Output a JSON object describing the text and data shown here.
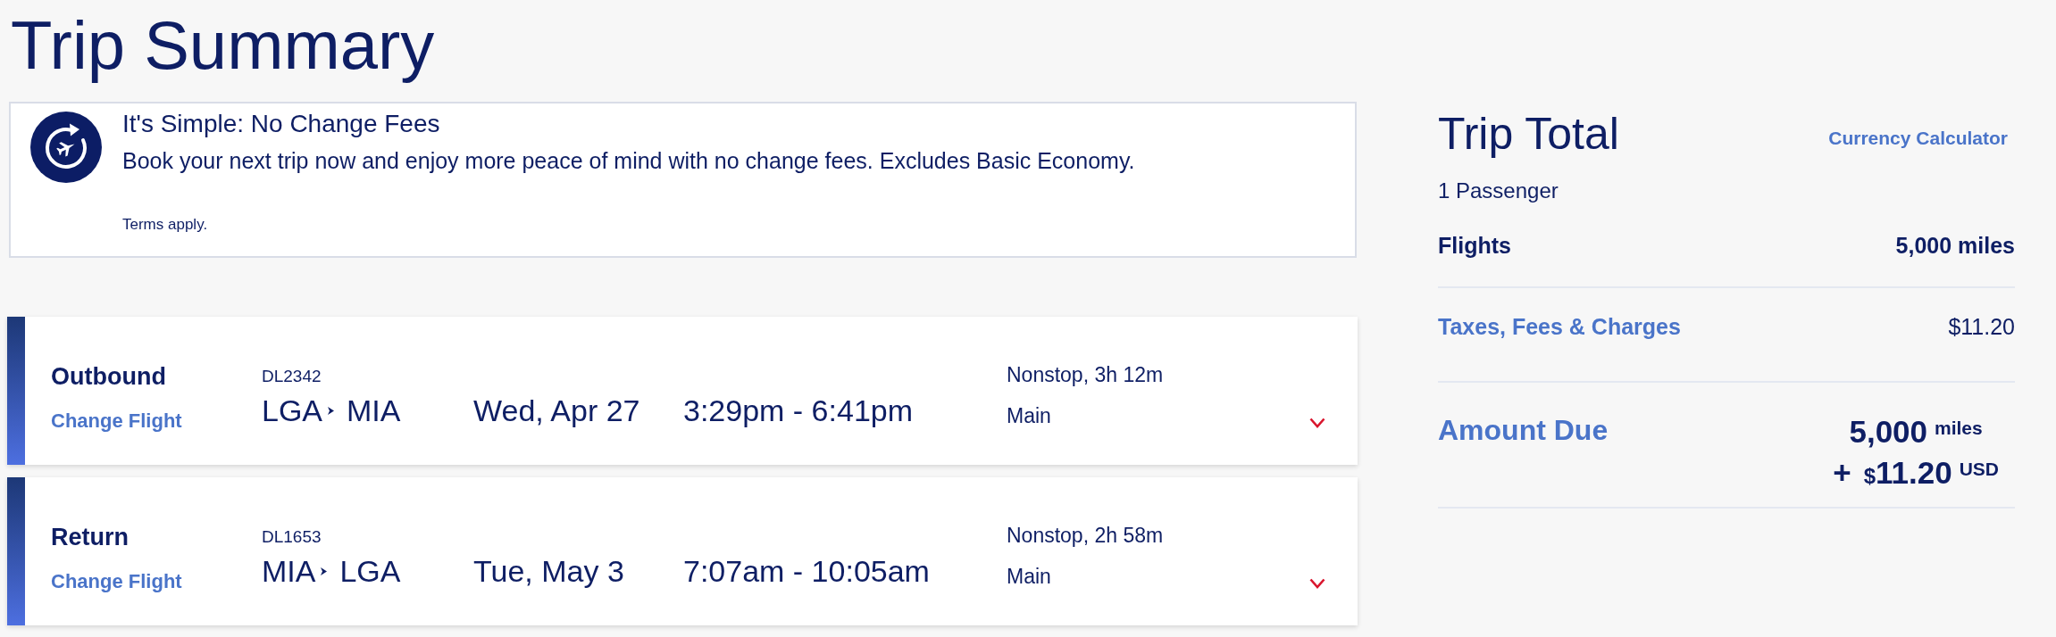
{
  "page": {
    "title": "Trip Summary"
  },
  "banner": {
    "heading": "It's Simple: No Change Fees",
    "body": "Book your next trip now and enjoy more peace of mind with no change fees. Excludes Basic Economy.",
    "terms": "Terms apply."
  },
  "flights": [
    {
      "direction": "Outbound",
      "change_link": "Change Flight",
      "flight_number": "DL2342",
      "origin": "LGA",
      "destination": "MIA",
      "date": "Wed, Apr 27",
      "times": "3:29pm - 6:41pm",
      "stops_duration": "Nonstop, 3h 12m",
      "cabin": "Main",
      "expanded": false
    },
    {
      "direction": "Return",
      "change_link": "Change Flight",
      "flight_number": "DL1653",
      "origin": "MIA",
      "destination": "LGA",
      "date": "Tue, May 3",
      "times": "7:07am - 10:05am",
      "stops_duration": "Nonstop, 2h 58m",
      "cabin": "Main",
      "expanded": false
    }
  ],
  "trip_total": {
    "title": "Trip Total",
    "currency_link": "Currency Calculator",
    "passengers": "1 Passenger",
    "lines": [
      {
        "kind": "plain",
        "label": "Flights",
        "value": "5,000 miles"
      },
      {
        "kind": "link",
        "label": "Taxes, Fees & Charges",
        "value": "$11.20"
      }
    ],
    "amount_due": {
      "label": "Amount Due",
      "miles": "5,000",
      "miles_unit": "miles",
      "plus": "+",
      "currency_symbol": "$",
      "cash": "11.20",
      "cash_unit": "USD"
    }
  }
}
